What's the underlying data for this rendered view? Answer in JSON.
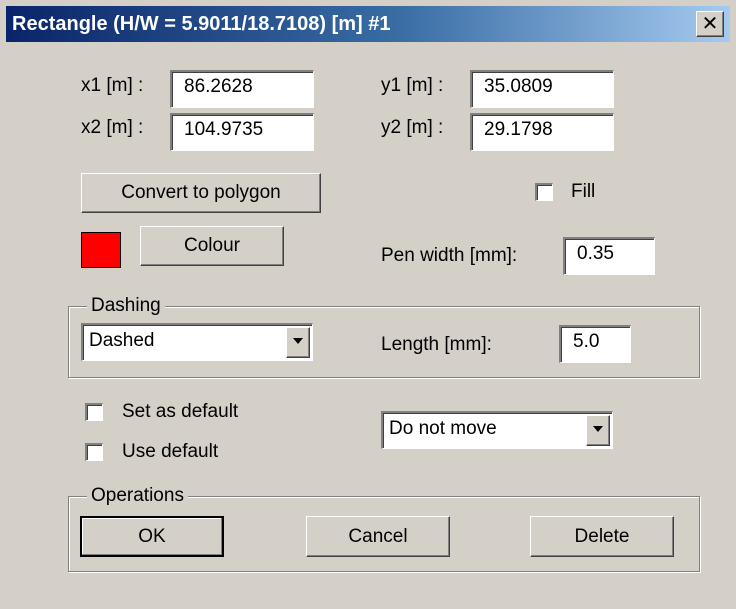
{
  "window": {
    "title": "Rectangle (H/W = 5.9011/18.7108) [m]   #1",
    "close_symbol": "✕"
  },
  "coords": {
    "x1_label": "x1 [m] :",
    "x1_value": "86.2628",
    "x2_label": "x2 [m] :",
    "x2_value": "104.9735",
    "y1_label": "y1 [m] :",
    "y1_value": "35.0809",
    "y2_label": "y2 [m] :",
    "y2_value": "29.1798"
  },
  "actions": {
    "convert_label": "Convert to polygon",
    "colour_label": "Colour",
    "colour_swatch": "#ff0000"
  },
  "fill": {
    "label": "Fill",
    "checked": false
  },
  "pen": {
    "label": "Pen width [mm]:",
    "value": "0.35"
  },
  "dashing": {
    "group_title": "Dashing",
    "style_selected": "Dashed",
    "length_label": "Length [mm]:",
    "length_value": "5.0"
  },
  "defaults": {
    "set_as_default_label": "Set as default",
    "set_as_default_checked": false,
    "use_default_label": "Use default",
    "use_default_checked": false,
    "move_selected": "Do not move"
  },
  "operations": {
    "group_title": "Operations",
    "ok_label": "OK",
    "cancel_label": "Cancel",
    "delete_label": "Delete"
  },
  "colors": {
    "title_gradient_start": "#0a246a",
    "title_gradient_end": "#a6caf0",
    "dialog_background": "#d4d0c8"
  },
  "icons": [
    "close-icon",
    "dropdown-arrow-icon"
  ]
}
